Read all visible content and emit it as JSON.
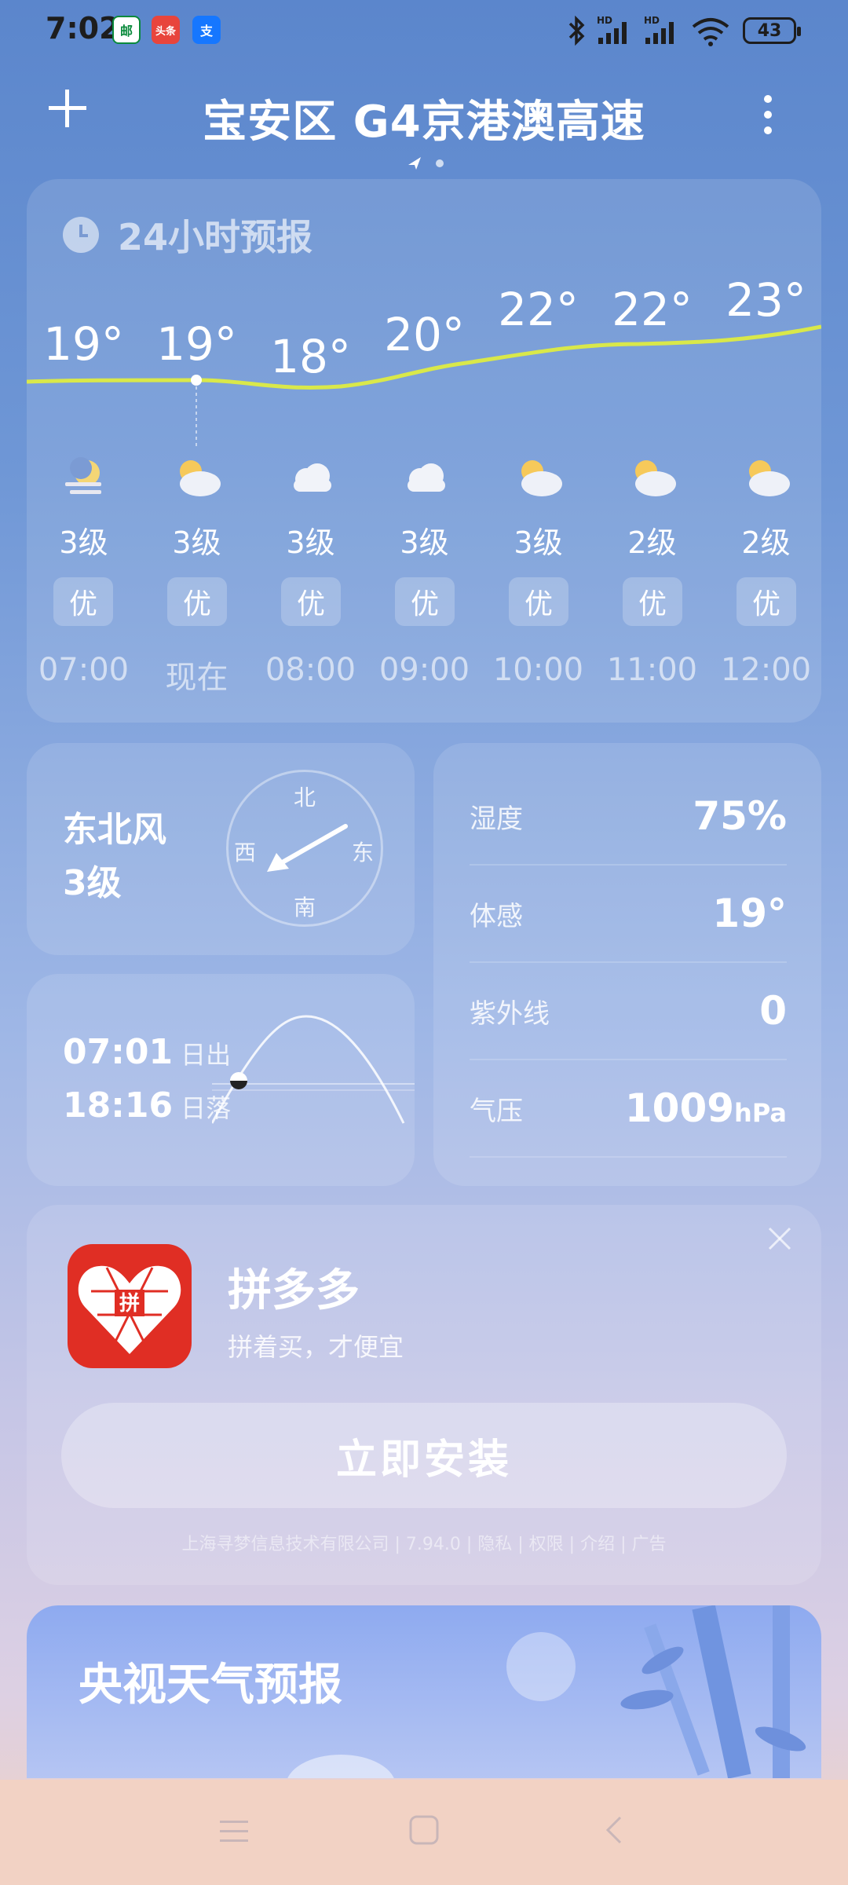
{
  "status": {
    "time": "7:02",
    "apps": [
      {
        "name": "china-post-icon",
        "text": "邮",
        "bg": "#ffffff",
        "fg": "#0a8a3c"
      },
      {
        "name": "toutiao-icon",
        "text": "头条",
        "bg": "#e8453c",
        "fg": "#ffffff"
      },
      {
        "name": "alipay-icon",
        "text": "支",
        "bg": "#1677ff",
        "fg": "#ffffff"
      }
    ],
    "battery": "43"
  },
  "header": {
    "title": "宝安区 G4京港澳高速"
  },
  "hourly": {
    "title": "24小时预报",
    "temps": [
      "19°",
      "19°",
      "18°",
      "20°",
      "22°",
      "22°",
      "23°"
    ],
    "winds": [
      "3级",
      "3级",
      "3级",
      "3级",
      "3级",
      "2级",
      "2级"
    ],
    "aqi": [
      "优",
      "优",
      "优",
      "优",
      "优",
      "优",
      "优"
    ],
    "hours": [
      "07:00",
      "现在",
      "08:00",
      "09:00",
      "10:00",
      "11:00",
      "12:00"
    ],
    "icons": [
      "moon-cloud-icon",
      "sun-cloud-icon",
      "cloud-icon",
      "cloud-icon",
      "sun-cloud-icon",
      "sun-cloud-icon",
      "sun-cloud-icon"
    ]
  },
  "wind": {
    "direction": "东北风",
    "level": "3级",
    "compass": {
      "n": "北",
      "s": "南",
      "w": "西",
      "e": "东"
    }
  },
  "sun": {
    "sunrise_time": "07:01",
    "sunrise_label": "日出",
    "sunset_time": "18:16",
    "sunset_label": "日落"
  },
  "details": {
    "humidity_label": "湿度",
    "humidity": "75%",
    "feels_label": "体感",
    "feels": "19°",
    "uv_label": "紫外线",
    "uv": "0",
    "pressure_label": "气压",
    "pressure": "1009",
    "pressure_unit": "hPa"
  },
  "ad": {
    "app_name": "拼多多",
    "slogan": "拼着买，才便宜",
    "install": "立即安装",
    "meta": "上海寻梦信息技术有限公司 | 7.94.0 | 隐私 | 权限 | 介绍 | 广告",
    "icon_char": "拼"
  },
  "cctv": {
    "title": "央视天气预报"
  }
}
